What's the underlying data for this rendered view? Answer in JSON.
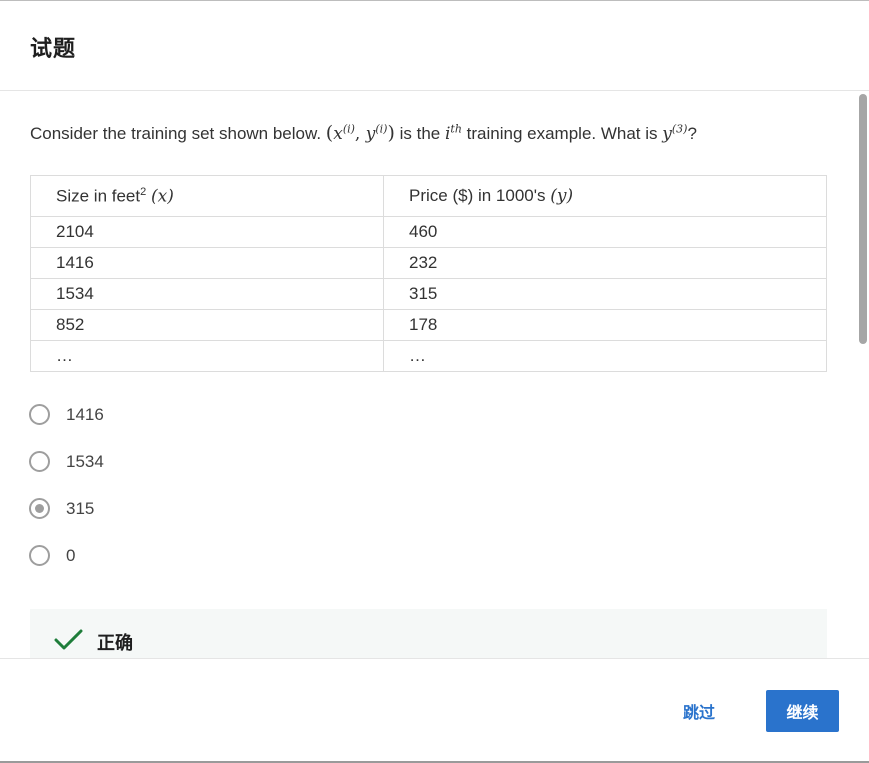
{
  "header": {
    "title": "试题"
  },
  "question": {
    "prefix": "Consider the training set shown below.",
    "x_var": "x",
    "y_var": "y",
    "superscript_i": "(i)",
    "comma": ",",
    "middle": "is the",
    "i_var": "i",
    "th": "th",
    "suffix": "training example. What is",
    "superscript_3": "(3)",
    "question_mark": "?"
  },
  "table": {
    "col1_header_text": "Size in feet",
    "col1_header_sup": "2",
    "col1_header_var": "(x)",
    "col2_header_text": "Price ($) in 1000's",
    "col2_header_var": "(y)",
    "rows": [
      [
        "2104",
        "460"
      ],
      [
        "1416",
        "232"
      ],
      [
        "1534",
        "315"
      ],
      [
        "852",
        "178"
      ],
      [
        "…",
        "…"
      ]
    ]
  },
  "options": [
    {
      "label": "1416",
      "selected": false
    },
    {
      "label": "1534",
      "selected": false
    },
    {
      "label": "315",
      "selected": true
    },
    {
      "label": "0",
      "selected": false
    }
  ],
  "feedback": {
    "icon": "check-icon",
    "text": "正确",
    "color": "#1e7d3a"
  },
  "footer": {
    "skip_label": "跳过",
    "continue_label": "继续"
  },
  "colors": {
    "accent": "#2a73cc",
    "radio": "#9e9e9e",
    "feedback_bg": "#f5f8f7"
  }
}
